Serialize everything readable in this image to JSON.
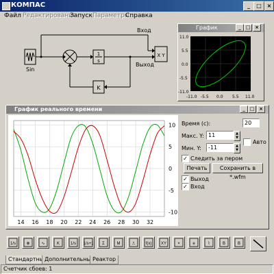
{
  "window": {
    "title": "КОМПАС"
  },
  "menu": [
    {
      "label": "Файл",
      "enabled": true
    },
    {
      "label": "Редактирование",
      "enabled": false
    },
    {
      "label": "Запуск",
      "enabled": true
    },
    {
      "label": "Параметры",
      "enabled": false
    },
    {
      "label": "Справка",
      "enabled": true
    }
  ],
  "diagram": {
    "label_input": "Вход",
    "label_output": "Выход",
    "label_sin": "Sin",
    "integrator_num": "1",
    "integrator_den": "s",
    "gain_label": "K",
    "xy_label": "X Y"
  },
  "xy_window": {
    "title": "График",
    "y_ticks": [
      "11.0",
      "5.5",
      "0.0",
      "-5.5",
      "-11.0"
    ],
    "x_ticks": [
      "-11.0",
      "-5.5",
      "0.0",
      "5.5",
      "11.0"
    ],
    "line_color": "#00cc00"
  },
  "rt_window": {
    "title": "График реального времени",
    "time_label": "Время (с):",
    "time_value": "20",
    "ymax_label": "Макс. Y:",
    "ymax_value": "11",
    "ymin_label": "Мин. Y:",
    "ymin_value": "-11",
    "auto_label": "Авто",
    "auto_checked": false,
    "follow_label": "Следить за пером",
    "follow_checked": true,
    "print_label": "Печать",
    "save_label": "Сохранить в *.wfm",
    "legend": [
      {
        "label": "Выход",
        "checked": true,
        "color": "#cc0000"
      },
      {
        "label": "Вход",
        "checked": true,
        "color": "#00aa00"
      }
    ]
  },
  "chart_data": {
    "type": "line",
    "xlim": [
      13,
      34
    ],
    "ylim": [
      -11,
      11
    ],
    "x_ticks": [
      14,
      16,
      18,
      20,
      22,
      24,
      26,
      28,
      30,
      32
    ],
    "y_ticks": [
      10,
      5,
      0,
      -5,
      -10
    ],
    "grid": true,
    "series": [
      {
        "name": "Вход",
        "color": "#00aa00",
        "points": [
          [
            13,
            9
          ],
          [
            14,
            4.2
          ],
          [
            15,
            -2.4
          ],
          [
            16,
            -7.9
          ],
          [
            17,
            -10.0
          ],
          [
            18,
            -9.2
          ],
          [
            19,
            -5.0
          ],
          [
            20,
            1.2
          ],
          [
            21,
            7.1
          ],
          [
            22,
            9.8
          ],
          [
            23,
            9.6
          ],
          [
            24,
            5.8
          ],
          [
            25,
            -0.2
          ],
          [
            26,
            -6.2
          ],
          [
            27,
            -9.6
          ],
          [
            28,
            -9.9
          ],
          [
            29,
            -6.5
          ],
          [
            30,
            -0.6
          ],
          [
            31,
            5.5
          ],
          [
            32,
            9.4
          ],
          [
            33,
            10.0
          ],
          [
            34,
            7.5
          ]
        ]
      },
      {
        "name": "Выход",
        "color": "#cc0000",
        "points": [
          [
            13,
            8.5
          ],
          [
            14,
            6.8
          ],
          [
            15,
            3.0
          ],
          [
            16,
            -2.5
          ],
          [
            17,
            -7.0
          ],
          [
            18,
            -9.8
          ],
          [
            19,
            -10.0
          ],
          [
            20,
            -6.5
          ],
          [
            21,
            -1.0
          ],
          [
            22,
            4.8
          ],
          [
            23,
            8.9
          ],
          [
            24,
            9.8
          ],
          [
            25,
            7.6
          ],
          [
            26,
            2.0
          ],
          [
            27,
            -4.0
          ],
          [
            28,
            -8.6
          ],
          [
            29,
            -10.0
          ],
          [
            30,
            -8.0
          ],
          [
            31,
            -2.8
          ],
          [
            32,
            3.2
          ],
          [
            33,
            8.0
          ],
          [
            34,
            9.8
          ]
        ]
      }
    ]
  },
  "palette": {
    "items": [
      "transfer-function",
      "summator",
      "generator",
      "gain",
      "integrator",
      "aperiodic",
      "switch",
      "oscillator",
      "relay",
      "function",
      "xy-recorder",
      "multiplier",
      "exponent",
      "delay",
      "bus-in",
      "bus-out"
    ]
  },
  "tabs": [
    {
      "label": "Стандартные",
      "active": true
    },
    {
      "label": "Дополнительные",
      "active": false
    },
    {
      "label": "Реактор",
      "active": false
    }
  ],
  "status": {
    "text": "Счетчик сбоев: 1"
  }
}
